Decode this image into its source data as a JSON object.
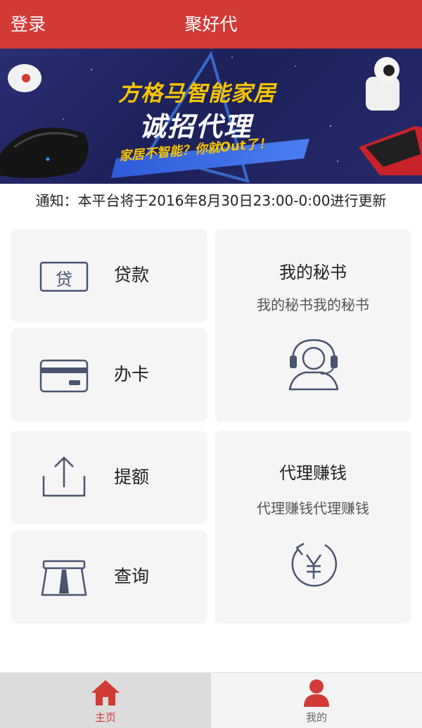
{
  "header": {
    "login_label": "登录",
    "title": "聚好代"
  },
  "banner": {
    "line1": "方格马智能家居",
    "line2": "诚招代理",
    "line3": "家居不智能？你就Out了！"
  },
  "notice": {
    "text": "通知：本平台将于2016年8月30日23:00-0:00进行更新"
  },
  "menu": {
    "loan": "贷款",
    "loan_icon_char": "贷",
    "card": "办卡",
    "limit": "提额",
    "query": "查询"
  },
  "secretary": {
    "title": "我的秘书",
    "subtitle": "我的秘书我的秘书"
  },
  "agent": {
    "title": "代理赚钱",
    "subtitle": "代理赚钱代理赚钱"
  },
  "tabs": {
    "home": "主页",
    "mine": "我的"
  },
  "colors": {
    "brand_red": "#d23a36",
    "icon_navy": "#4a5470"
  }
}
